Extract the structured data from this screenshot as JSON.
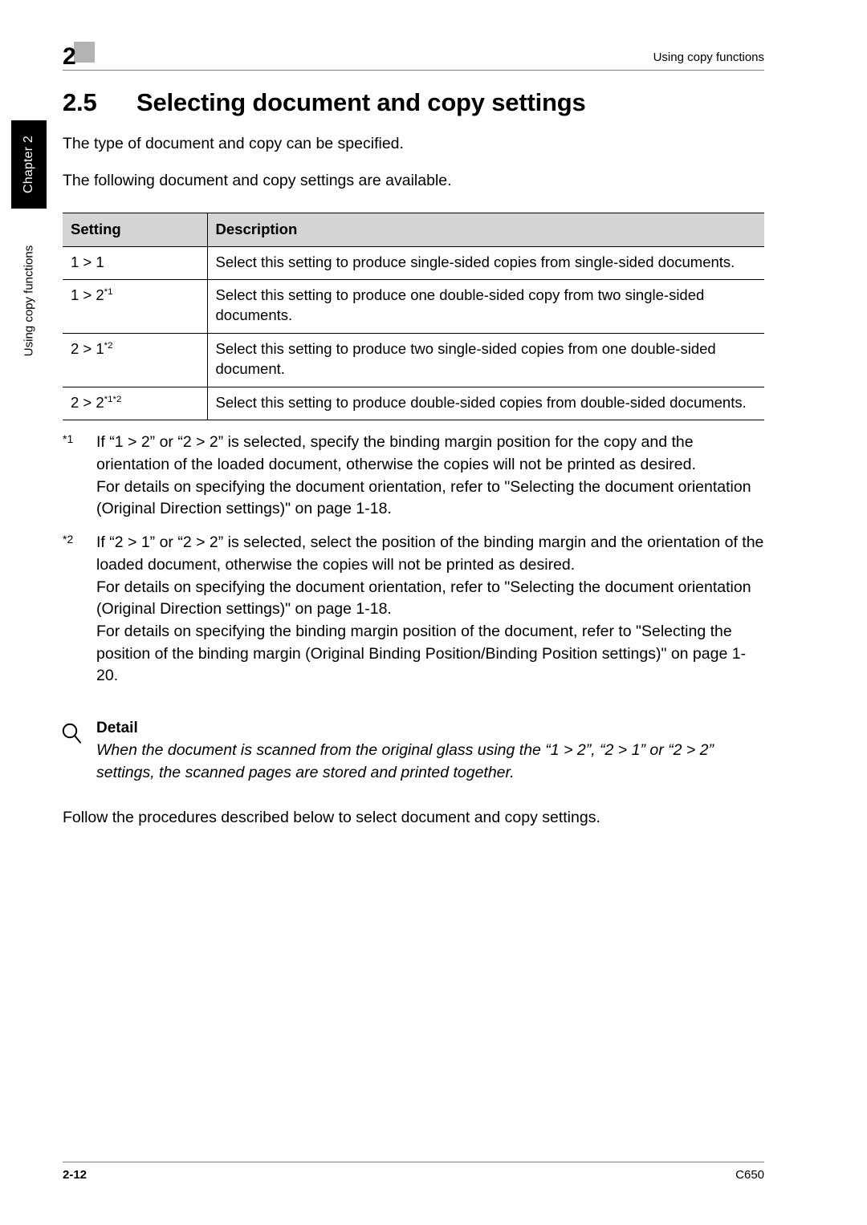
{
  "sidebar": {
    "chapter_tab": "Chapter 2",
    "running_head": "Using copy functions"
  },
  "header": {
    "chapter_number": "2",
    "running_title": "Using copy functions"
  },
  "section": {
    "number": "2.5",
    "title": "Selecting document and copy settings"
  },
  "intro": {
    "paragraph_1": "The type of document and copy can be specified.",
    "paragraph_2": "The following document and copy settings are available."
  },
  "table": {
    "headers": {
      "setting": "Setting",
      "description": "Description"
    },
    "rows": [
      {
        "setting": "1 > 1",
        "setting_sup": "",
        "description": "Select this setting to produce single-sided copies from single-sided documents."
      },
      {
        "setting": "1 > 2",
        "setting_sup": "*1",
        "description": "Select this setting to produce one double-sided copy from two single-sided documents."
      },
      {
        "setting": "2 > 1",
        "setting_sup": "*2",
        "description": "Select this setting to produce two single-sided copies from one double-sided document."
      },
      {
        "setting": "2 > 2",
        "setting_sup": "*1*2",
        "description": "Select this setting to produce double-sided copies from double-sided documents."
      }
    ]
  },
  "footnotes": [
    {
      "marker": "*1",
      "blocks": [
        "If “1 > 2” or “2 > 2” is selected, specify the binding margin position for the copy and the orientation of the loaded document, otherwise the copies will not be printed as desired.",
        "For details on specifying the document orientation, refer to \"Selecting the document orientation (Original Direction settings)\" on page 1-18."
      ]
    },
    {
      "marker": "*2",
      "blocks": [
        "If “2 > 1” or “2 > 2” is selected, select the position of the binding margin and the orientation of the loaded document, otherwise the copies will not be printed as desired.",
        "For details on specifying the document orientation, refer to \"Selecting the document orientation (Original Direction settings)\" on page 1-18.",
        "For details on specifying the binding margin position of the document, refer to \"Selecting the position of the binding margin (Original Binding Position/Binding Position settings)\" on page 1-20."
      ]
    }
  ],
  "detail": {
    "icon": "magnifier-icon",
    "label": "Detail",
    "body": "When the document is scanned from the original glass using the “1 > 2”, “2 > 1” or “2 > 2” settings, the scanned pages are stored and printed together."
  },
  "closing": {
    "paragraph": "Follow the procedures described below to select document and copy settings."
  },
  "footer": {
    "page_number": "2-12",
    "model": "C650"
  },
  "colors": {
    "header_box_gray": "#b3b3b3",
    "table_header_gray": "#d4d4d4",
    "rule_gray": "#808080",
    "chapter_tab_black": "#000000"
  }
}
